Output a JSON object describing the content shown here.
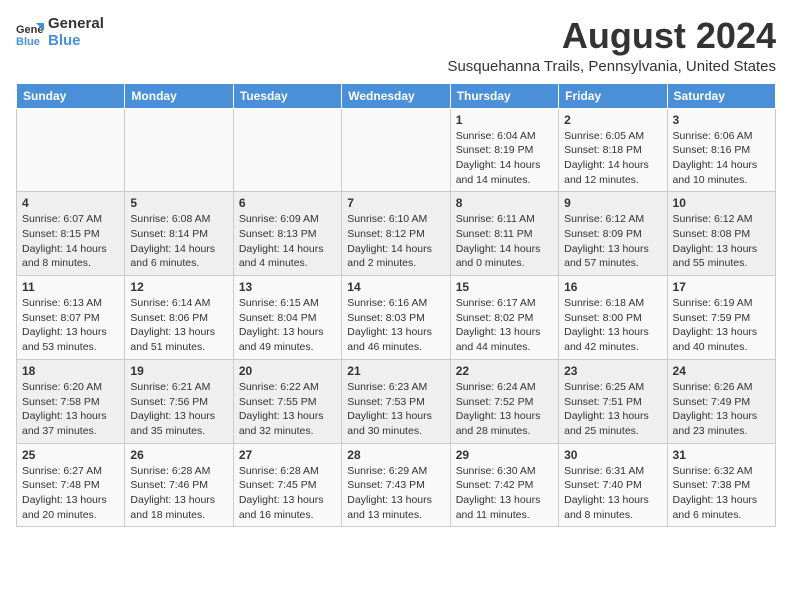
{
  "logo": {
    "text_general": "General",
    "text_blue": "Blue"
  },
  "title": "August 2024",
  "subtitle": "Susquehanna Trails, Pennsylvania, United States",
  "headers": [
    "Sunday",
    "Monday",
    "Tuesday",
    "Wednesday",
    "Thursday",
    "Friday",
    "Saturday"
  ],
  "weeks": [
    [
      {
        "day": "",
        "info": ""
      },
      {
        "day": "",
        "info": ""
      },
      {
        "day": "",
        "info": ""
      },
      {
        "day": "",
        "info": ""
      },
      {
        "day": "1",
        "info": "Sunrise: 6:04 AM\nSunset: 8:19 PM\nDaylight: 14 hours\nand 14 minutes."
      },
      {
        "day": "2",
        "info": "Sunrise: 6:05 AM\nSunset: 8:18 PM\nDaylight: 14 hours\nand 12 minutes."
      },
      {
        "day": "3",
        "info": "Sunrise: 6:06 AM\nSunset: 8:16 PM\nDaylight: 14 hours\nand 10 minutes."
      }
    ],
    [
      {
        "day": "4",
        "info": "Sunrise: 6:07 AM\nSunset: 8:15 PM\nDaylight: 14 hours\nand 8 minutes."
      },
      {
        "day": "5",
        "info": "Sunrise: 6:08 AM\nSunset: 8:14 PM\nDaylight: 14 hours\nand 6 minutes."
      },
      {
        "day": "6",
        "info": "Sunrise: 6:09 AM\nSunset: 8:13 PM\nDaylight: 14 hours\nand 4 minutes."
      },
      {
        "day": "7",
        "info": "Sunrise: 6:10 AM\nSunset: 8:12 PM\nDaylight: 14 hours\nand 2 minutes."
      },
      {
        "day": "8",
        "info": "Sunrise: 6:11 AM\nSunset: 8:11 PM\nDaylight: 14 hours\nand 0 minutes."
      },
      {
        "day": "9",
        "info": "Sunrise: 6:12 AM\nSunset: 8:09 PM\nDaylight: 13 hours\nand 57 minutes."
      },
      {
        "day": "10",
        "info": "Sunrise: 6:12 AM\nSunset: 8:08 PM\nDaylight: 13 hours\nand 55 minutes."
      }
    ],
    [
      {
        "day": "11",
        "info": "Sunrise: 6:13 AM\nSunset: 8:07 PM\nDaylight: 13 hours\nand 53 minutes."
      },
      {
        "day": "12",
        "info": "Sunrise: 6:14 AM\nSunset: 8:06 PM\nDaylight: 13 hours\nand 51 minutes."
      },
      {
        "day": "13",
        "info": "Sunrise: 6:15 AM\nSunset: 8:04 PM\nDaylight: 13 hours\nand 49 minutes."
      },
      {
        "day": "14",
        "info": "Sunrise: 6:16 AM\nSunset: 8:03 PM\nDaylight: 13 hours\nand 46 minutes."
      },
      {
        "day": "15",
        "info": "Sunrise: 6:17 AM\nSunset: 8:02 PM\nDaylight: 13 hours\nand 44 minutes."
      },
      {
        "day": "16",
        "info": "Sunrise: 6:18 AM\nSunset: 8:00 PM\nDaylight: 13 hours\nand 42 minutes."
      },
      {
        "day": "17",
        "info": "Sunrise: 6:19 AM\nSunset: 7:59 PM\nDaylight: 13 hours\nand 40 minutes."
      }
    ],
    [
      {
        "day": "18",
        "info": "Sunrise: 6:20 AM\nSunset: 7:58 PM\nDaylight: 13 hours\nand 37 minutes."
      },
      {
        "day": "19",
        "info": "Sunrise: 6:21 AM\nSunset: 7:56 PM\nDaylight: 13 hours\nand 35 minutes."
      },
      {
        "day": "20",
        "info": "Sunrise: 6:22 AM\nSunset: 7:55 PM\nDaylight: 13 hours\nand 32 minutes."
      },
      {
        "day": "21",
        "info": "Sunrise: 6:23 AM\nSunset: 7:53 PM\nDaylight: 13 hours\nand 30 minutes."
      },
      {
        "day": "22",
        "info": "Sunrise: 6:24 AM\nSunset: 7:52 PM\nDaylight: 13 hours\nand 28 minutes."
      },
      {
        "day": "23",
        "info": "Sunrise: 6:25 AM\nSunset: 7:51 PM\nDaylight: 13 hours\nand 25 minutes."
      },
      {
        "day": "24",
        "info": "Sunrise: 6:26 AM\nSunset: 7:49 PM\nDaylight: 13 hours\nand 23 minutes."
      }
    ],
    [
      {
        "day": "25",
        "info": "Sunrise: 6:27 AM\nSunset: 7:48 PM\nDaylight: 13 hours\nand 20 minutes."
      },
      {
        "day": "26",
        "info": "Sunrise: 6:28 AM\nSunset: 7:46 PM\nDaylight: 13 hours\nand 18 minutes."
      },
      {
        "day": "27",
        "info": "Sunrise: 6:28 AM\nSunset: 7:45 PM\nDaylight: 13 hours\nand 16 minutes."
      },
      {
        "day": "28",
        "info": "Sunrise: 6:29 AM\nSunset: 7:43 PM\nDaylight: 13 hours\nand 13 minutes."
      },
      {
        "day": "29",
        "info": "Sunrise: 6:30 AM\nSunset: 7:42 PM\nDaylight: 13 hours\nand 11 minutes."
      },
      {
        "day": "30",
        "info": "Sunrise: 6:31 AM\nSunset: 7:40 PM\nDaylight: 13 hours\nand 8 minutes."
      },
      {
        "day": "31",
        "info": "Sunrise: 6:32 AM\nSunset: 7:38 PM\nDaylight: 13 hours\nand 6 minutes."
      }
    ]
  ]
}
